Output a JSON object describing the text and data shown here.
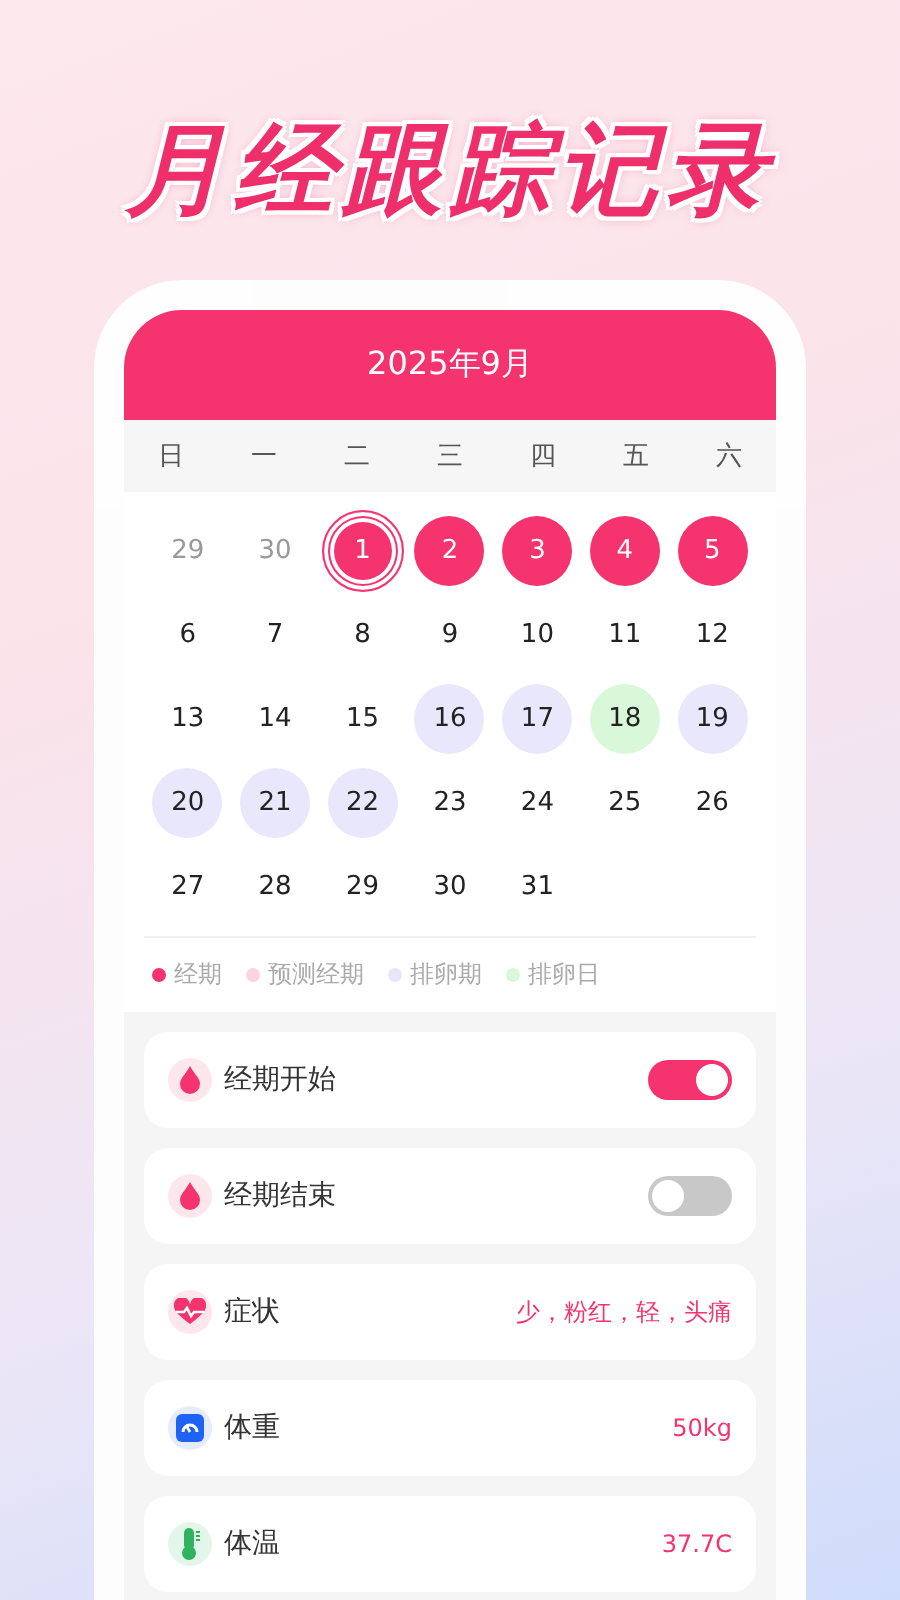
{
  "headline": "月经跟踪记录",
  "calendar": {
    "title": "2025年9月",
    "weekdays": [
      "日",
      "一",
      "二",
      "三",
      "四",
      "五",
      "六"
    ],
    "days": [
      {
        "label": "29",
        "kind": "other",
        "selected": false
      },
      {
        "label": "30",
        "kind": "other",
        "selected": false
      },
      {
        "label": "1",
        "kind": "period",
        "selected": true
      },
      {
        "label": "2",
        "kind": "period",
        "selected": false
      },
      {
        "label": "3",
        "kind": "period",
        "selected": false
      },
      {
        "label": "4",
        "kind": "period",
        "selected": false
      },
      {
        "label": "5",
        "kind": "period",
        "selected": false
      },
      {
        "label": "6",
        "kind": "normal",
        "selected": false
      },
      {
        "label": "7",
        "kind": "normal",
        "selected": false
      },
      {
        "label": "8",
        "kind": "normal",
        "selected": false
      },
      {
        "label": "9",
        "kind": "normal",
        "selected": false
      },
      {
        "label": "10",
        "kind": "normal",
        "selected": false
      },
      {
        "label": "11",
        "kind": "normal",
        "selected": false
      },
      {
        "label": "12",
        "kind": "normal",
        "selected": false
      },
      {
        "label": "13",
        "kind": "normal",
        "selected": false
      },
      {
        "label": "14",
        "kind": "normal",
        "selected": false
      },
      {
        "label": "15",
        "kind": "normal",
        "selected": false
      },
      {
        "label": "16",
        "kind": "ovulation",
        "selected": false
      },
      {
        "label": "17",
        "kind": "ovulation",
        "selected": false
      },
      {
        "label": "18",
        "kind": "ovulation-day",
        "selected": false
      },
      {
        "label": "19",
        "kind": "ovulation",
        "selected": false
      },
      {
        "label": "20",
        "kind": "ovulation",
        "selected": false
      },
      {
        "label": "21",
        "kind": "ovulation",
        "selected": false
      },
      {
        "label": "22",
        "kind": "ovulation",
        "selected": false
      },
      {
        "label": "23",
        "kind": "normal",
        "selected": false
      },
      {
        "label": "24",
        "kind": "normal",
        "selected": false
      },
      {
        "label": "25",
        "kind": "normal",
        "selected": false
      },
      {
        "label": "26",
        "kind": "normal",
        "selected": false
      },
      {
        "label": "27",
        "kind": "normal",
        "selected": false
      },
      {
        "label": "28",
        "kind": "normal",
        "selected": false
      },
      {
        "label": "29",
        "kind": "normal",
        "selected": false
      },
      {
        "label": "30",
        "kind": "normal",
        "selected": false
      },
      {
        "label": "31",
        "kind": "normal",
        "selected": false
      }
    ],
    "legend": [
      {
        "label": "经期",
        "color": "#f5336f"
      },
      {
        "label": "预测经期",
        "color": "#fcd3de"
      },
      {
        "label": "排卵期",
        "color": "#e8e6fb"
      },
      {
        "label": "排卵日",
        "color": "#d9f7d9"
      }
    ]
  },
  "records": [
    {
      "kind": "toggle",
      "label": "经期开始",
      "on": true
    },
    {
      "kind": "toggle",
      "label": "经期结束",
      "on": false
    },
    {
      "kind": "value",
      "label": "症状",
      "value": "少，粉红，轻，头痛"
    },
    {
      "kind": "value",
      "label": "体重",
      "value": "50kg"
    },
    {
      "kind": "value",
      "label": "体温",
      "value": "37.7C"
    }
  ]
}
